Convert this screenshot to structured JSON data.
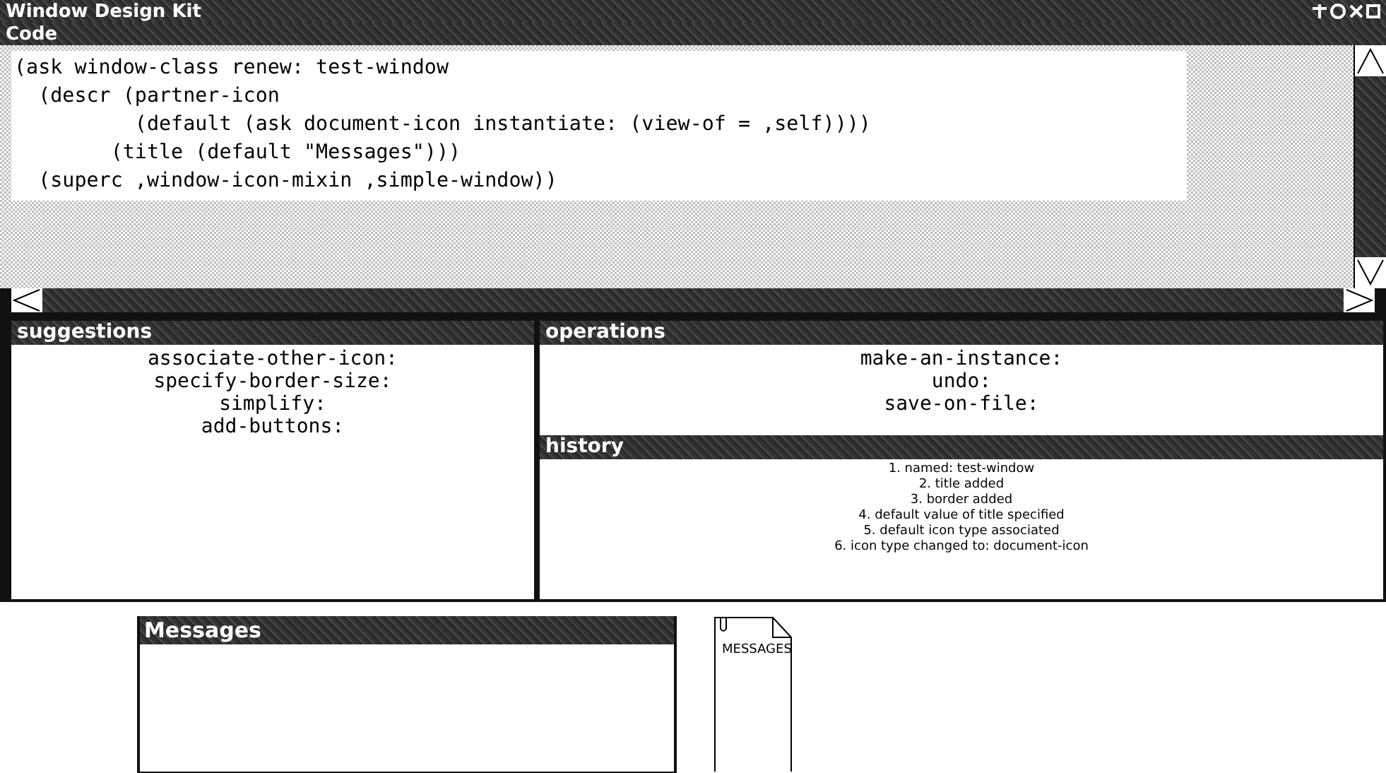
{
  "window": {
    "title": "Window Design Kit"
  },
  "code": {
    "title": "Code",
    "lines": [
      "(ask window-class renew: test-window",
      "  (descr (partner-icon",
      "          (default (ask document-icon instantiate: (view-of = ,self))))",
      "        (title (default \"Messages\")))",
      "  (superc ,window-icon-mixin ,simple-window))"
    ]
  },
  "suggestions": {
    "title": "suggestions",
    "items": [
      "associate-other-icon:",
      "specify-border-size:",
      "simplify:",
      "add-buttons:"
    ]
  },
  "operations": {
    "title": "operations",
    "items": [
      "make-an-instance:",
      "undo:",
      "save-on-file:"
    ]
  },
  "history": {
    "title": "history",
    "items": [
      "1. named: test-window",
      "2. title added",
      "3. border added",
      "4. default value of title specified",
      "5. default icon type associated",
      "6. icon type changed to: document-icon"
    ]
  },
  "messages_window": {
    "title": "Messages"
  },
  "document_icon": {
    "label": "MESSAGES"
  }
}
